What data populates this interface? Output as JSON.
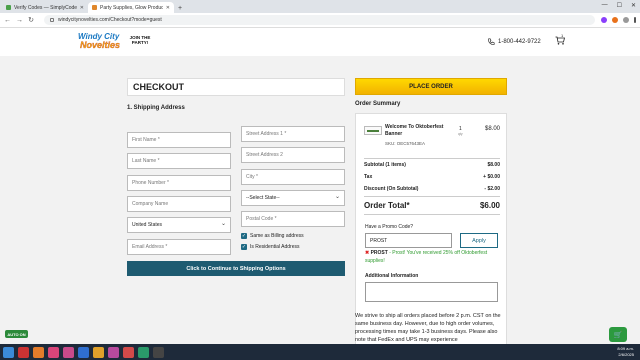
{
  "browser": {
    "tabs": [
      {
        "label": "Verify Codes — SimplyCodes",
        "active": false
      },
      {
        "label": "Party Supplies, Glow Products, N",
        "active": true
      }
    ],
    "url": "windycitynovelties.com/Checkout?mode=guest"
  },
  "header": {
    "logo_line1": "Windy City",
    "logo_line2": "Novelties",
    "logo_party": "JOIN THE PARTY!",
    "phone": "1-800-442-9722",
    "cart_count": "1"
  },
  "checkout": {
    "title": "CHECKOUT",
    "section": "1. Shipping Address",
    "fields": {
      "first_name": "First Name *",
      "last_name": "Last Name *",
      "phone": "Phone Number *",
      "company": "Company Name",
      "country": "United States",
      "email": "Email Address *",
      "street1": "Street Address 1 *",
      "street2": "Street Address 2",
      "city": "City *",
      "state": "--Select State--",
      "postal": "Postal Code *"
    },
    "same_billing": "Same as Billing address",
    "residential": "Is Residential Address",
    "continue_button": "Click to Continue to Shipping Options"
  },
  "order": {
    "place_order": "PLACE ORDER",
    "summary_title": "Order Summary",
    "item": {
      "name": "Welcome To Oktoberfest Banner",
      "sku": "SKU: OEC57643EA",
      "qty": "1",
      "qty_label": "qty",
      "price": "$8.00"
    },
    "subtotal_label": "Subtotal (1 items)",
    "subtotal_value": "$8.00",
    "tax_label": "Tax",
    "tax_value": "+ $0.00",
    "discount_label": "Discount (On Subtotal)",
    "discount_value": "- $2.00",
    "total_label": "Order Total*",
    "total_value": "$6.00",
    "promo_label": "Have a Promo Code?",
    "promo_value": "PROST",
    "apply_button": "Apply",
    "promo_code": "PROST",
    "promo_message": " - Prost! You've received 25% off Oktoberfest supplies!",
    "additional_label": "Additional Information",
    "ship_note": "We strive to ship all orders placed before 2 p.m. CST on the same business day. However, due to high order volumes, processing times may take 1-3 business days. Please also note that FedEx and UPS may experience"
  },
  "widgets": {
    "auto_on": "AUTO ON"
  },
  "taskbar": {
    "time": "8:09 a.m.",
    "date": "2/6/2025"
  }
}
